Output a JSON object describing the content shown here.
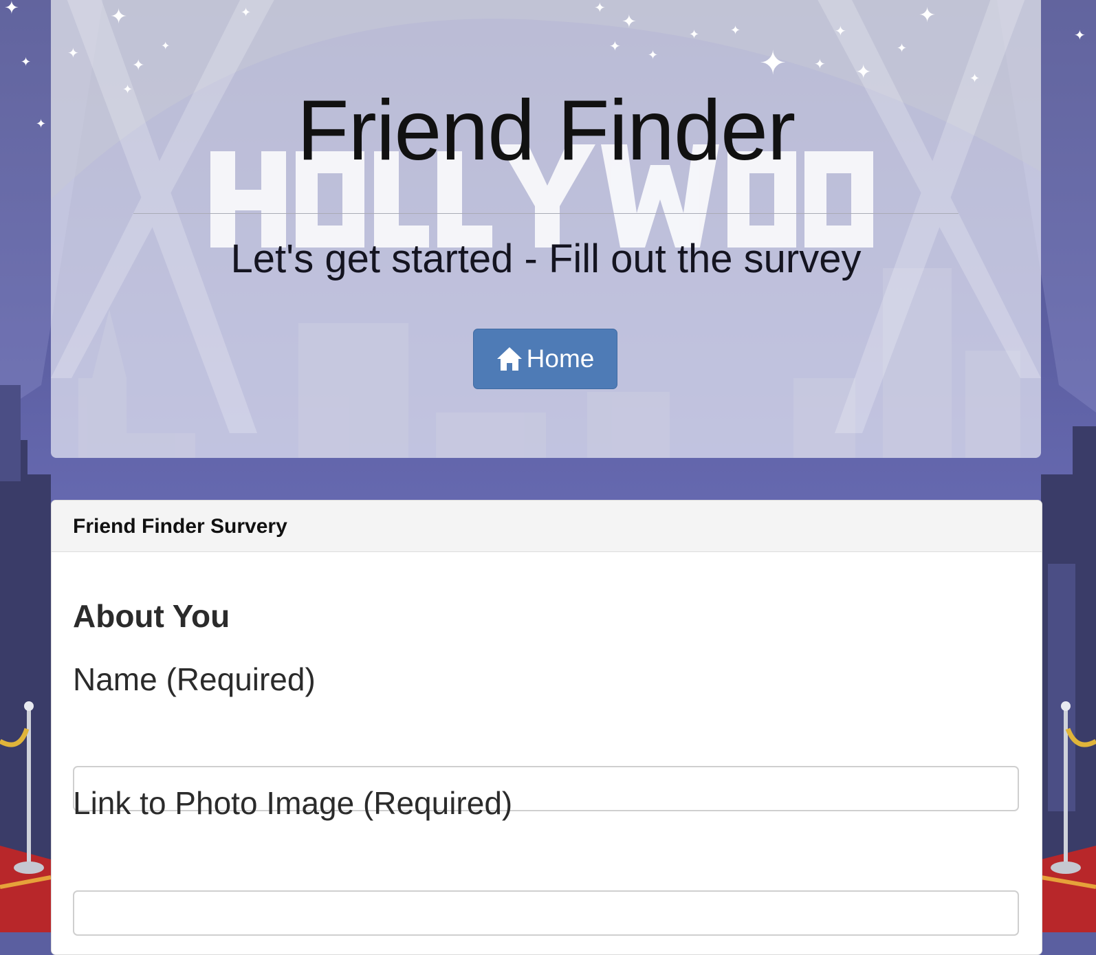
{
  "colors": {
    "background_sky": "#5b5fa0",
    "jumbotron_bg": "#e6e8f4",
    "button_primary": "#4e7bb6",
    "panel_heading_bg": "#f4f4f4",
    "carpet": "#c0282a"
  },
  "jumbotron": {
    "title": "Friend Finder",
    "subtitle": "Let's get started - Fill out the survey",
    "home_button": {
      "icon": "home-icon",
      "label": "Home"
    }
  },
  "panel": {
    "heading": "Friend Finder Survery",
    "section_title": "About You",
    "fields": {
      "name": {
        "label": "Name (Required)",
        "value": "",
        "placeholder": ""
      },
      "photo": {
        "label": "Link to Photo Image (Required)",
        "value": "",
        "placeholder": ""
      }
    }
  }
}
